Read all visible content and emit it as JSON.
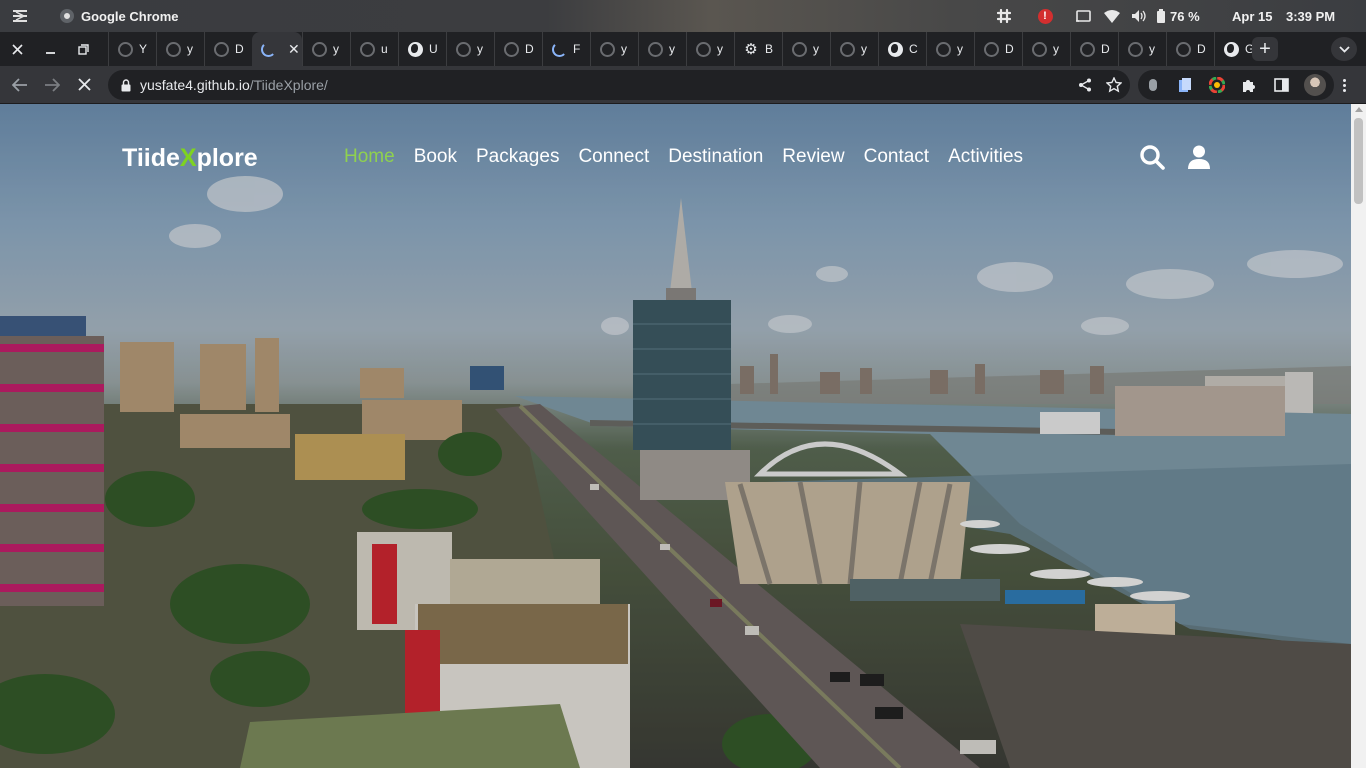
{
  "os": {
    "app_name": "Google Chrome",
    "battery": "76 %",
    "date": "Apr 15",
    "time": "3:39 PM",
    "alert_symbol": "!"
  },
  "tabs": [
    {
      "letter": "Y",
      "icon": "github-icon"
    },
    {
      "letter": "y",
      "icon": "github-icon"
    },
    {
      "letter": "D",
      "icon": "github-icon"
    },
    {
      "letter": "",
      "icon": "loading-spinner-icon",
      "active": true
    },
    {
      "letter": "y",
      "icon": "github-icon"
    },
    {
      "letter": "u",
      "icon": "github-icon"
    },
    {
      "letter": "U",
      "icon": "globe-icon"
    },
    {
      "letter": "y",
      "icon": "github-icon"
    },
    {
      "letter": "D",
      "icon": "github-icon"
    },
    {
      "letter": "F",
      "icon": "loading-spinner-icon"
    },
    {
      "letter": "y",
      "icon": "github-icon"
    },
    {
      "letter": "y",
      "icon": "github-icon"
    },
    {
      "letter": "y",
      "icon": "github-icon"
    },
    {
      "letter": "B",
      "icon": "gear-icon"
    },
    {
      "letter": "y",
      "icon": "github-icon"
    },
    {
      "letter": "y",
      "icon": "github-icon"
    },
    {
      "letter": "C",
      "icon": "globe-icon"
    },
    {
      "letter": "y",
      "icon": "github-icon"
    },
    {
      "letter": "D",
      "icon": "github-icon"
    },
    {
      "letter": "y",
      "icon": "github-icon"
    },
    {
      "letter": "D",
      "icon": "github-icon"
    },
    {
      "letter": "y",
      "icon": "github-icon"
    },
    {
      "letter": "D",
      "icon": "github-icon"
    },
    {
      "letter": "G",
      "icon": "globe-icon"
    }
  ],
  "new_tab_label": "+",
  "address": {
    "host": "yusfate4.github.io",
    "path": "/TiideXplore/"
  },
  "site": {
    "logo_prefix": "Tiide",
    "logo_x": "X",
    "logo_suffix": "plore",
    "accent_color": "#7ed321",
    "nav": [
      "Home",
      "Book",
      "Packages",
      "Connect",
      "Destination",
      "Review",
      "Contact",
      "Activities"
    ],
    "active_nav": "Home"
  }
}
